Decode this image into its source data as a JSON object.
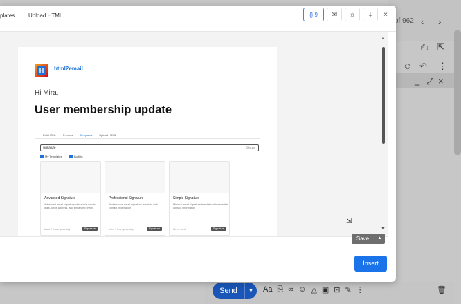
{
  "modal": {
    "tabs": [
      "plates",
      "Upload HTML"
    ],
    "toolbar": {
      "variables_label": "{} 9",
      "close": "×"
    },
    "email": {
      "brand": "html2email",
      "greeting": "Hi Mira,",
      "headline": "User membership update",
      "screenshot": {
        "tabs": [
          "Edit HTML",
          "Preview",
          "Templates",
          "Upload HTML"
        ],
        "search_value": "signature",
        "found": "3 found",
        "filters": [
          "My Templates",
          "Built-In"
        ],
        "cards": [
          {
            "title": "Advanced Signature",
            "desc": "Advanced email signature with social media links, office address, and enhanced styling",
            "meta": "Used 2 times, yesterday",
            "tag": "Signature"
          },
          {
            "title": "Professional Signature",
            "desc": "Professional email signature template with contact information",
            "meta": "Used 1 time, yesterday",
            "tag": "Signature"
          },
          {
            "title": "Simple Signature",
            "desc": "Minimal email signature template with essential contact information",
            "meta": "Never used",
            "tag": "Signature"
          }
        ]
      }
    },
    "save_label": "Save",
    "insert_label": "Insert"
  },
  "background": {
    "count": "of 962",
    "send_label": "Send"
  },
  "colors": {
    "accent": "#1a73e8",
    "brand": "#1e73d9",
    "send": "#1a56b8"
  }
}
